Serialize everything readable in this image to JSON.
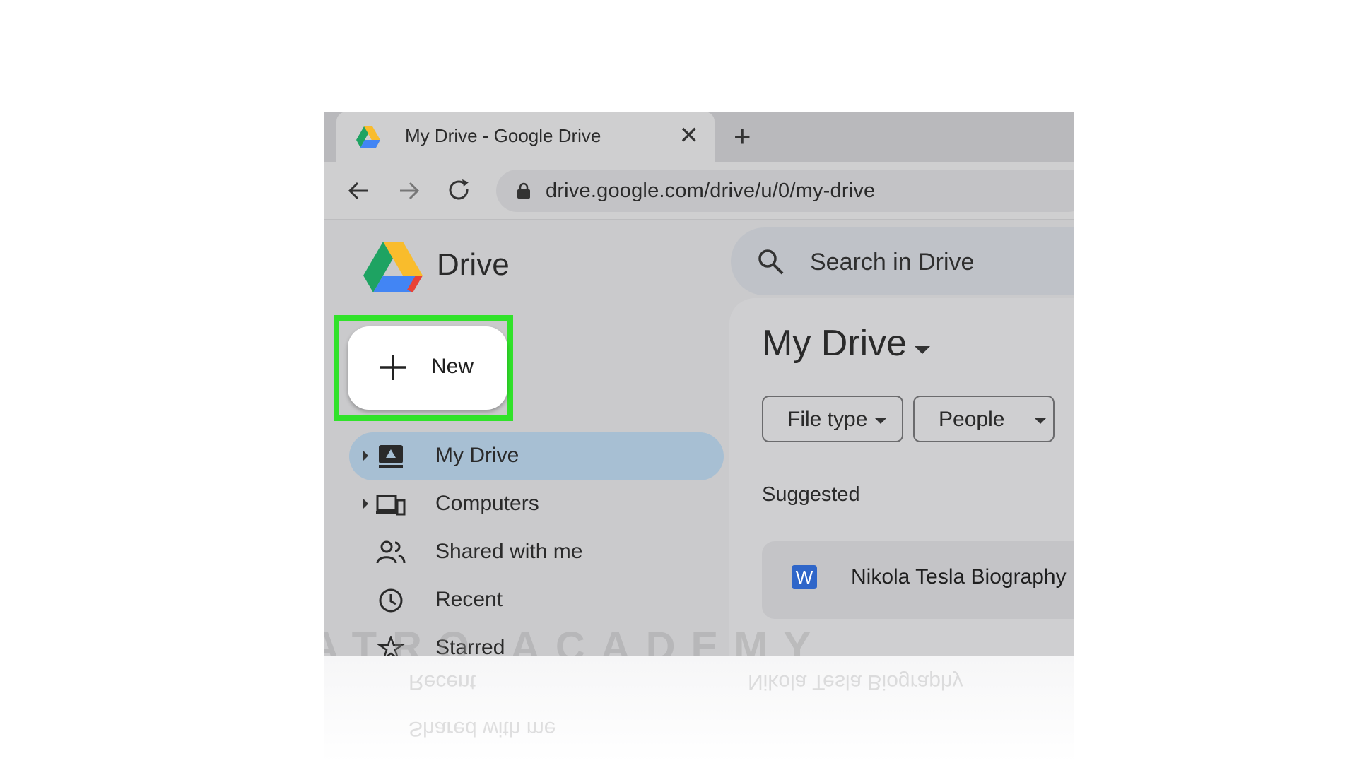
{
  "browser": {
    "tab_title": "My Drive - Google Drive",
    "url": "drive.google.com/drive/u/0/my-drive"
  },
  "drive": {
    "brand": "Drive",
    "search_placeholder": "Search in Drive",
    "new_button_label": "New",
    "nav": [
      {
        "label": "My Drive"
      },
      {
        "label": "Computers"
      },
      {
        "label": "Shared with me"
      },
      {
        "label": "Recent"
      },
      {
        "label": "Starred"
      }
    ],
    "heading": "My Drive",
    "filters": {
      "file_type": "File type",
      "people": "People"
    },
    "suggested_label": "Suggested",
    "suggested_file": {
      "icon": "W",
      "name": "Nikola Tesla Biography"
    }
  },
  "watermark": "ATRO ACADEMY",
  "colors": {
    "highlight": "#31e22a",
    "active_nav": "#a7bfd3",
    "word_icon": "#2f66c9"
  }
}
